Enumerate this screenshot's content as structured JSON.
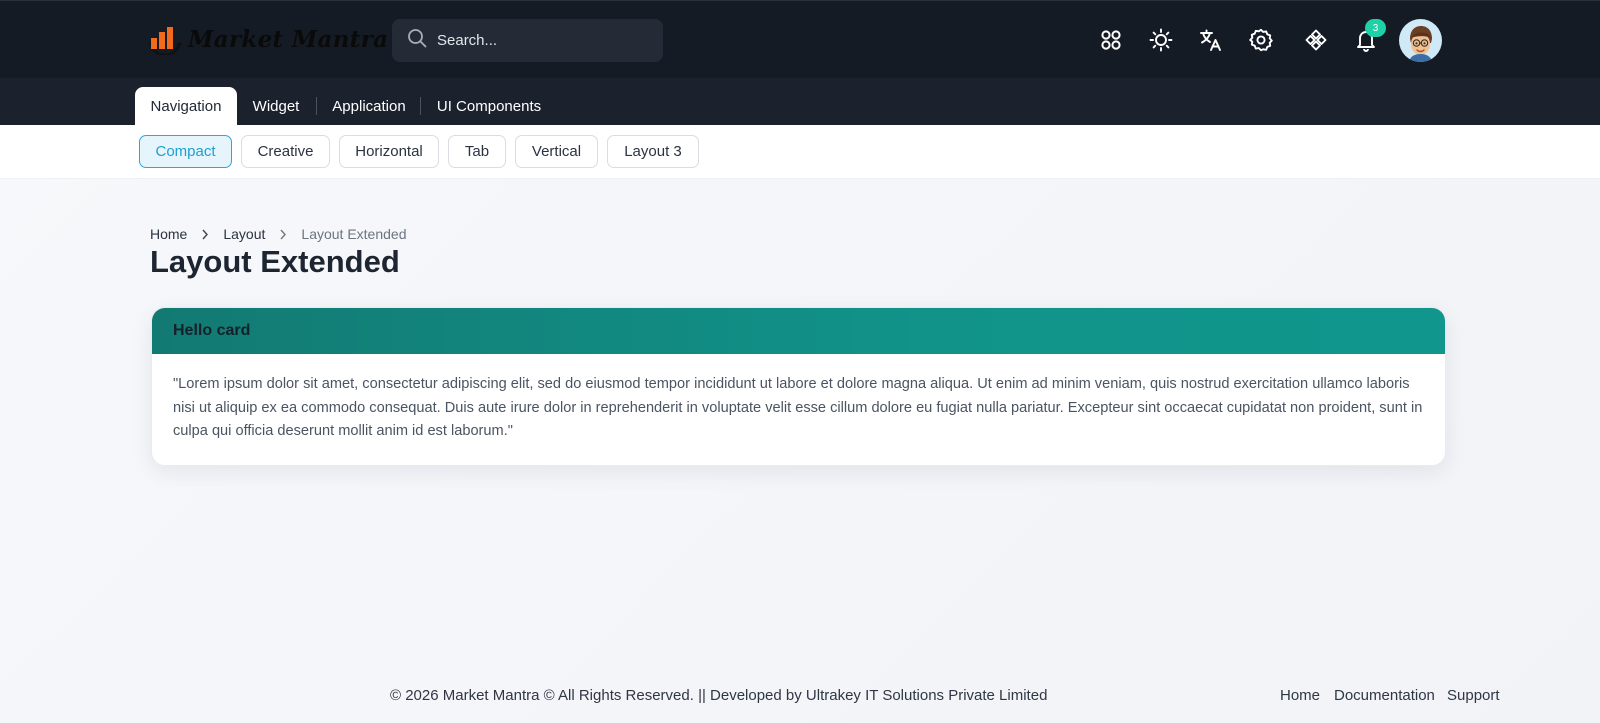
{
  "header": {
    "brand": "Market Mantra",
    "search": {
      "placeholder": "Search...",
      "value": ""
    },
    "icons": [
      "apps-icon",
      "sun-icon",
      "translate-icon",
      "settings-icon",
      "components-icon",
      "bell-icon"
    ],
    "notification_count": "3"
  },
  "main_nav": {
    "tabs": [
      {
        "label": "Navigation",
        "active": true
      },
      {
        "label": "Widget"
      },
      {
        "label": "Application"
      },
      {
        "label": "UI Components"
      }
    ]
  },
  "sub_nav": {
    "items": [
      {
        "label": "Compact",
        "active": true
      },
      {
        "label": "Creative"
      },
      {
        "label": "Horizontal"
      },
      {
        "label": "Tab"
      },
      {
        "label": "Vertical"
      },
      {
        "label": "Layout 3"
      }
    ]
  },
  "breadcrumb": [
    "Home",
    "Layout",
    "Layout Extended"
  ],
  "page_title": "Layout Extended",
  "card": {
    "title": "Hello card",
    "body": "\"Lorem ipsum dolor sit amet, consectetur adipiscing elit, sed do eiusmod tempor incididunt ut labore et dolore magna aliqua. Ut enim ad minim veniam, quis nostrud exercitation ullamco laboris nisi ut aliquip ex ea commodo consequat. Duis aute irure dolor in reprehenderit in voluptate velit esse cillum dolore eu fugiat nulla pariatur. Excepteur sint occaecat cupidatat non proident, sunt in culpa qui officia deserunt mollit anim id est laborum.\""
  },
  "footer": {
    "copyright": "© 2026 Market Mantra © All Rights Reserved. || Developed by Ultrakey IT Solutions Private Limited",
    "links": [
      "Home",
      "Documentation",
      "Support"
    ]
  },
  "colors": {
    "header_bg": "#151b25",
    "nav_bg": "#1b222d",
    "accent": "#1e9fd0",
    "card_header": "#11938a",
    "badge": "#1fd1a6",
    "logo_orange": "#f26a1b"
  }
}
